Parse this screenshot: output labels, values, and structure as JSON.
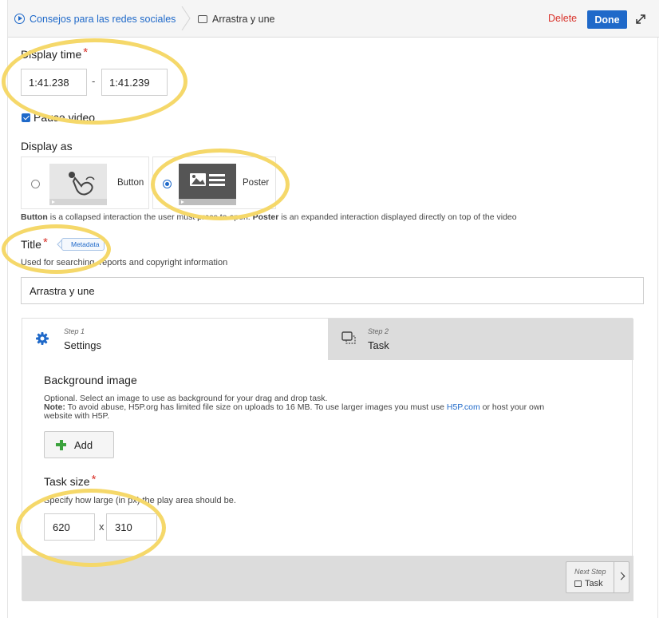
{
  "topbar": {
    "breadcrumb_parent": "Consejos para las redes sociales",
    "breadcrumb_current": "Arrastra y une",
    "delete_label": "Delete",
    "done_label": "Done"
  },
  "display_time": {
    "label": "Display time",
    "required_mark": "*",
    "start": "1:41.238",
    "separator": "-",
    "end": "1:41.239"
  },
  "pause_video": {
    "label": "Pause video",
    "checked": true
  },
  "display_as": {
    "label": "Display as",
    "options": [
      {
        "label": "Button",
        "selected": false
      },
      {
        "label": "Poster",
        "selected": true
      }
    ],
    "help_bold_1": "Button",
    "help_text_1": " is a collapsed interaction the user must press to open. ",
    "help_bold_2": "Poster",
    "help_text_2": " is an expanded interaction displayed directly on top of the video"
  },
  "title_field": {
    "label": "Title",
    "required_mark": "*",
    "badge": "Metadata",
    "description": "Used for searching, reports and copyright information",
    "value": "Arrastra y une"
  },
  "wizard": {
    "steps": [
      {
        "num": "Step 1",
        "name": "Settings",
        "active": true
      },
      {
        "num": "Step 2",
        "name": "Task",
        "active": false
      }
    ],
    "background_image": {
      "label": "Background image",
      "desc_line1": "Optional. Select an image to use as background for your drag and drop task.",
      "note_label": "Note:",
      "note_text": " To avoid abuse, H5P.org has limited file size on uploads to 16 MB. To use larger images you must use ",
      "note_link": "H5P.com",
      "note_text2": " or host your own",
      "note_line3": "website with H5P.",
      "add_label": "Add"
    },
    "task_size": {
      "label": "Task size",
      "required_mark": "*",
      "description": "Specify how large (in px) the play area should be.",
      "width": "620",
      "separator": "x",
      "height": "310"
    },
    "next_step": {
      "label": "Next Step",
      "target": "Task"
    }
  },
  "colors": {
    "accent": "#1f69c9",
    "delete": "#d9332b",
    "highlight": "#f5d86a",
    "add_green": "#3aa23c"
  }
}
